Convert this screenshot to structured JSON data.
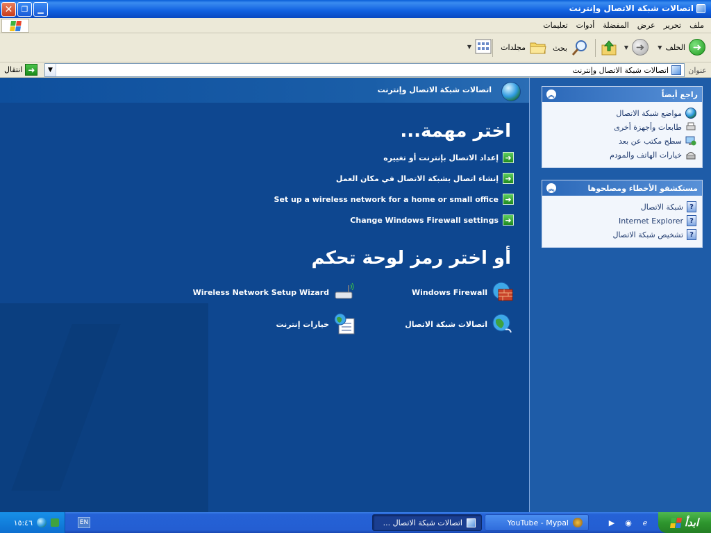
{
  "window": {
    "title": "اتصالات شبكة الاتصال وإنترنت",
    "buttons": {
      "close": "✕",
      "restore": "❐",
      "minimize": "▁"
    }
  },
  "menubar": {
    "items": [
      "ملف",
      "تحرير",
      "عرض",
      "المفضلة",
      "أدوات",
      "تعليمات"
    ]
  },
  "toolbar": {
    "back_label": "الخلف",
    "search_label": "بحث",
    "folders_label": "مجلدات"
  },
  "addressbar": {
    "label": "عنوان",
    "value": "اتصالات شبكة الاتصال وإنترنت",
    "go_label": "انتقال"
  },
  "main": {
    "breadcrumb": "اتصالات شبكة الاتصال وإنترنت",
    "pick_task_heading": "اختر مهمة...",
    "tasks": [
      "إعداد الاتصال بإنترنت أو تغييره",
      "إنشاء اتصال بشبكة الاتصال في مكان العمل",
      "Set up a wireless network for a home or small office",
      "Change Windows Firewall settings"
    ],
    "pick_icon_heading": "أو اختر رمز لوحة تحكم",
    "control_panel_icons": [
      {
        "label": "Windows Firewall",
        "icon": "firewall-icon"
      },
      {
        "label": "Wireless Network Setup Wizard",
        "icon": "wireless-wizard-icon"
      },
      {
        "label": "اتصالات شبكة الاتصال",
        "icon": "network-connections-icon"
      },
      {
        "label": "خيارات إنترنت",
        "icon": "internet-options-icon"
      }
    ]
  },
  "sidebar": {
    "see_also": {
      "title": "راجع أيضاً",
      "items": [
        "مواضع شبكة الاتصال",
        "طابعات وأجهزة أخرى",
        "سطح مكتب عن بعد",
        "خيارات الهاتف والمودم"
      ]
    },
    "troubleshooters": {
      "title": "مستكشفو الأخطاء ومصلحوها",
      "items": [
        "شبكة الاتصال",
        "Internet Explorer",
        "تشخيص شبكة الاتصال"
      ]
    }
  },
  "taskbar": {
    "start_label": "ابدأ",
    "buttons": [
      {
        "label": "اتصالات شبكة الاتصال ...",
        "active": true
      },
      {
        "label": "YouTube - Mypal",
        "active": false
      }
    ],
    "language": "EN",
    "clock": "١٥:٤٦"
  },
  "colors": {
    "content_bg": "#0e4790",
    "sidebar_bg": "#1e5ca8",
    "titlebar": "#0a5fd8",
    "taskbar": "#245ed2",
    "start_green": "#2e962e"
  }
}
